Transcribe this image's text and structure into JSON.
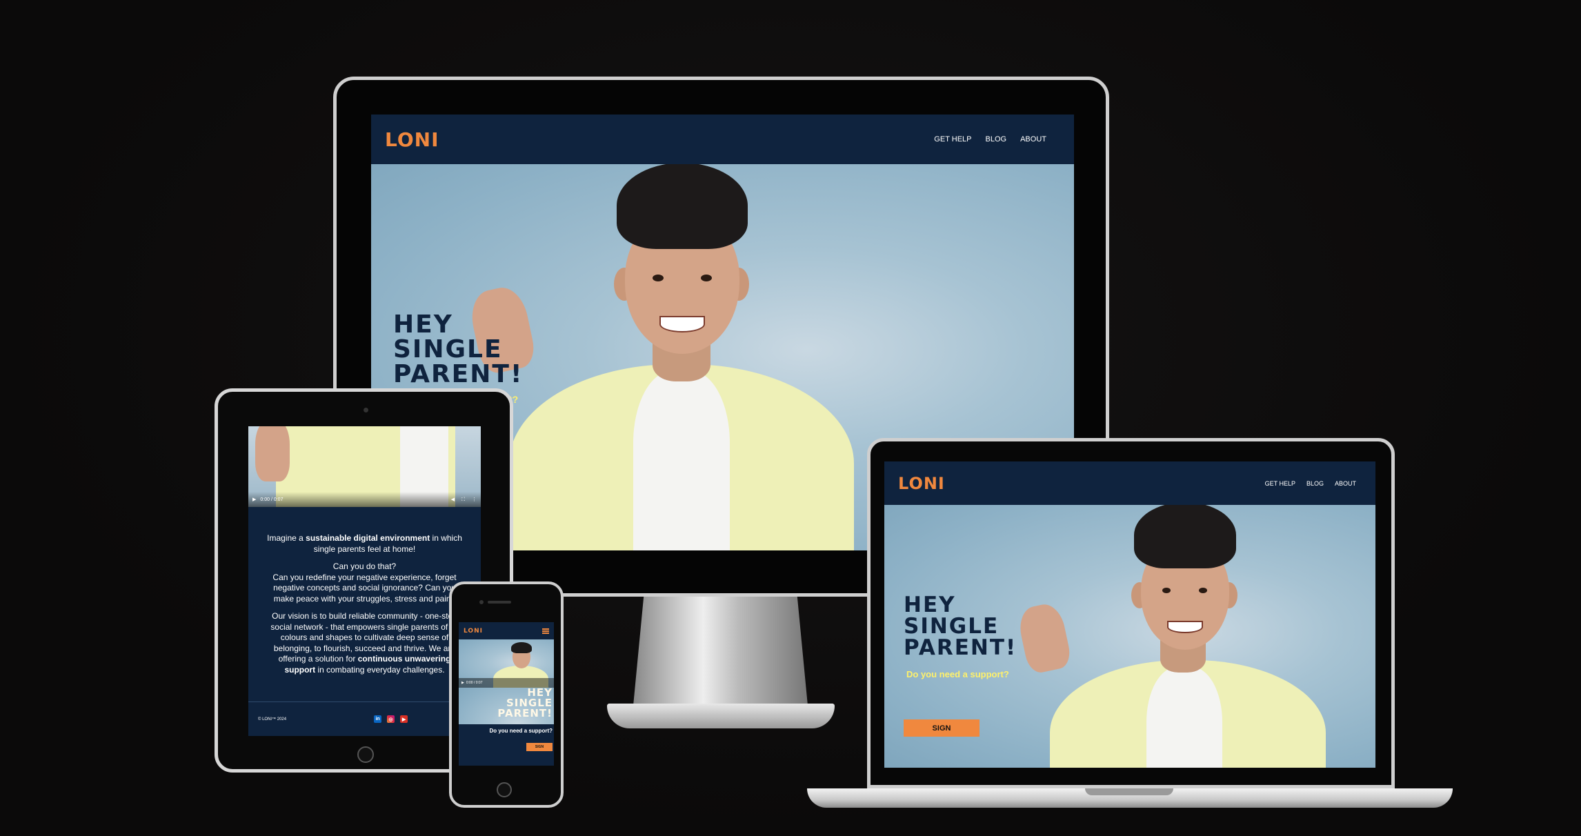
{
  "site": {
    "logo": "LONI",
    "nav": [
      "GET HELP",
      "BLOG",
      "ABOUT"
    ],
    "headline": [
      "HEY",
      "SINGLE",
      "PARENT!"
    ],
    "question": "Do you need a support?",
    "sign_button": "SIGN",
    "colors": {
      "navy": "#0f233e",
      "orange": "#f0883e",
      "yellow": "#fff16a"
    }
  },
  "desktop": {
    "question_fragment": "t?"
  },
  "tablet": {
    "video_time": "0:00 / 0:07",
    "p1_pre": "Imagine a ",
    "p1_bold": "sustainable digital environment",
    "p1_post": " in which single parents feel at home!",
    "p2_line1": "Can you do that?",
    "p2_rest": "Can you redefine your negative experience, forget negative concepts and social ignorance? Can you make peace with your struggles, stress and pain?",
    "p3_pre": "Our vision is to build reliable community - one-stop social network - that empowers single parents of all colours and shapes to cultivate deep sense of belonging, to flourish, succeed and thrive. We are offering a solution for ",
    "p3_bold": "continuous unwavering support",
    "p3_post": " in combating everyday challenges.",
    "copyright": "© LONI™ 2024",
    "social_icons": [
      "linkedin-icon",
      "instagram-icon",
      "youtube-icon"
    ]
  },
  "phone": {
    "video_time": "0:00 / 0:07",
    "menu_icon": "hamburger-menu-icon"
  }
}
